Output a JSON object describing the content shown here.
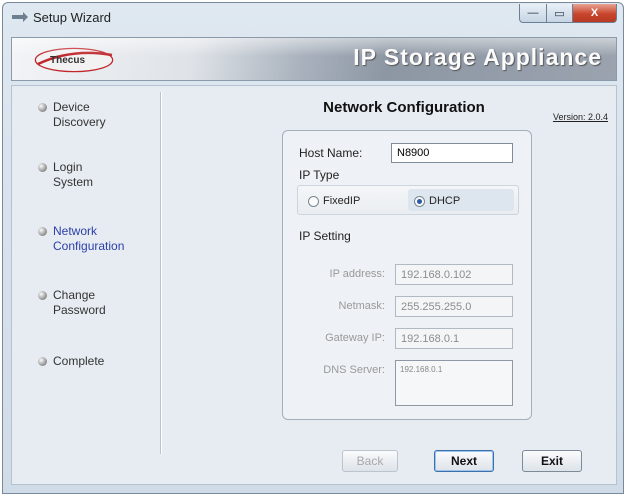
{
  "window": {
    "title": "Setup Wizard",
    "controls": {
      "minimize": "—",
      "maximize": "▭",
      "close": "X"
    }
  },
  "banner": {
    "logo_text": "Thecus",
    "title": "IP Storage Appliance"
  },
  "steps": [
    {
      "label_line1": "Device",
      "label_line2": "Discovery",
      "active": false
    },
    {
      "label_line1": "Login",
      "label_line2": "System",
      "active": false
    },
    {
      "label_line1": "Network",
      "label_line2": "Configuration",
      "active": true
    },
    {
      "label_line1": "Change",
      "label_line2": "Password",
      "active": false
    },
    {
      "label_line1": "Complete",
      "label_line2": "",
      "active": false
    }
  ],
  "main": {
    "heading": "Network Configuration",
    "version": "Version: 2.0.4"
  },
  "form": {
    "host_name_label": "Host Name:",
    "host_name_value": "N8900",
    "ip_type_label": "IP Type",
    "fixed_ip_label": "FixedIP",
    "dhcp_label": "DHCP",
    "selected_ip_type": "DHCP",
    "ip_setting_label": "IP Setting",
    "ip_address_label": "IP address:",
    "ip_address_value": "192.168.0.102",
    "netmask_label": "Netmask:",
    "netmask_value": "255.255.255.0",
    "gateway_label": "Gateway IP:",
    "gateway_value": "192.168.0.1",
    "dns_label": "DNS Server:",
    "dns_value": "192.168.0.1"
  },
  "buttons": {
    "back": "Back",
    "next": "Next",
    "exit": "Exit"
  }
}
